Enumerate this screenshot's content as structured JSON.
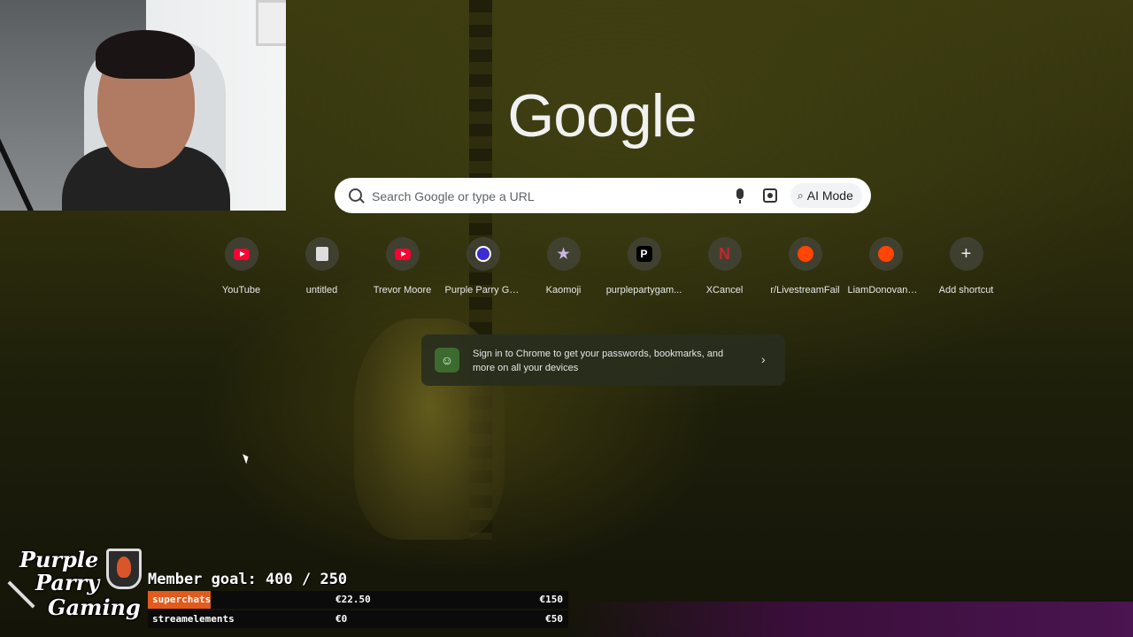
{
  "google": {
    "logo": "Google",
    "search_placeholder": "Search Google or type a URL",
    "ai_mode_label": "AI Mode"
  },
  "shortcuts": [
    {
      "label": "YouTube",
      "icon": "youtube-icon"
    },
    {
      "label": "untitled",
      "icon": "document-icon"
    },
    {
      "label": "Trevor Moore",
      "icon": "youtube-icon"
    },
    {
      "label": "Purple Parry Ga...",
      "icon": "purple-parry-icon"
    },
    {
      "label": "Kaomoji",
      "icon": "star-icon"
    },
    {
      "label": "purplepartygam...",
      "icon": "p-icon"
    },
    {
      "label": "XCancel",
      "icon": "n-icon"
    },
    {
      "label": "r/LivestreamFail",
      "icon": "reddit-icon"
    },
    {
      "label": "LiamDonovanM...",
      "icon": "reddit-icon"
    },
    {
      "label": "Add shortcut",
      "icon": "plus-icon"
    }
  ],
  "signin": {
    "text": "Sign in to Chrome to get your passwords, bookmarks, and more on all your devices"
  },
  "stream": {
    "brand": [
      "Purple",
      "Parry",
      "Gaming"
    ],
    "goal_text": "Member goal: 400 / 250",
    "bars": [
      {
        "name": "superchats",
        "current": "€22.50",
        "max": "€150",
        "progress": 0.15,
        "color": "#e25a1c"
      },
      {
        "name": "streamelements",
        "current": "€0",
        "max": "€50",
        "progress": 0.0,
        "color": "#e25a1c"
      }
    ]
  }
}
